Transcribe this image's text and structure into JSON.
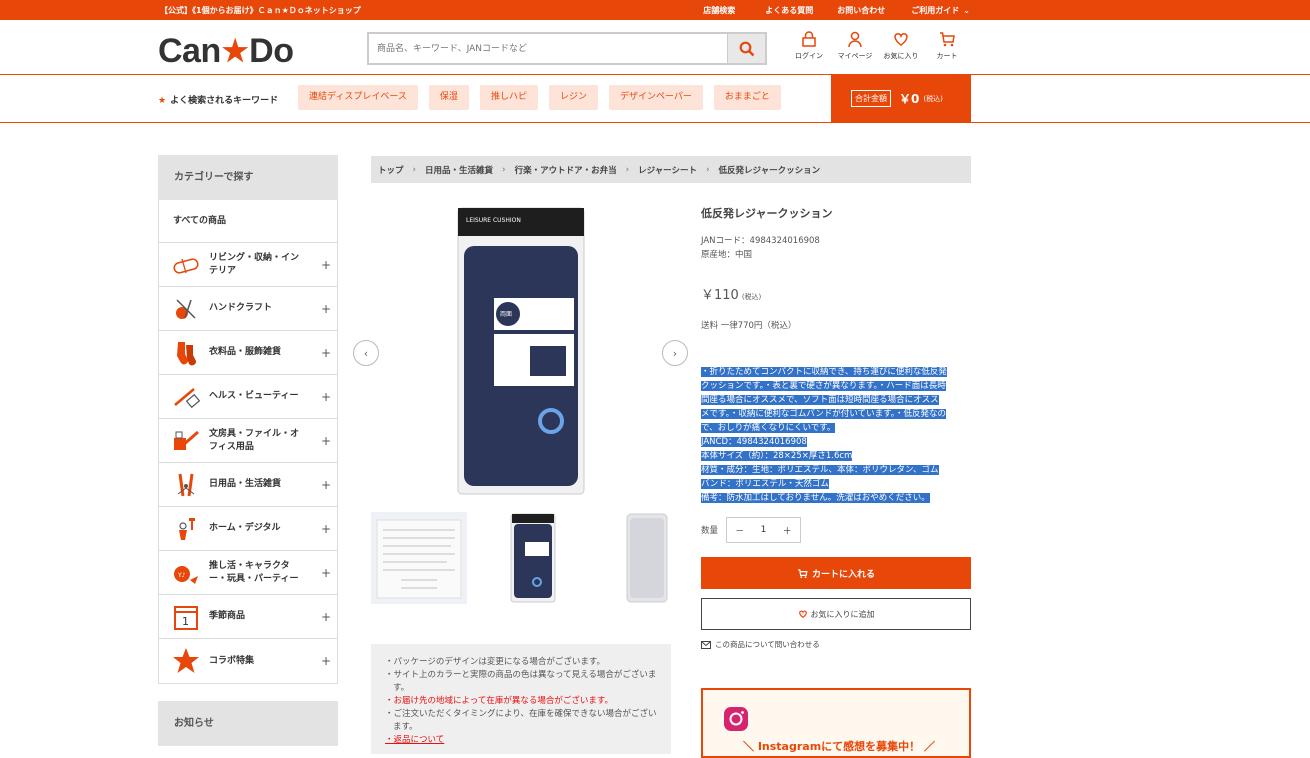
{
  "topbar": {
    "site_title": "【公式】《1個からお届け》Ｃａｎ★Ｄｏネットショップ",
    "links": [
      "店舗検索",
      "よくある質問",
      "お問い合わせ",
      "ご利用ガイド"
    ]
  },
  "header": {
    "logo_left": "Can",
    "logo_star": "★",
    "logo_right": "Do",
    "search_placeholder": "商品名、キーワード、JANコードなど",
    "icons": [
      {
        "label": "ログイン",
        "icon": "lock-icon"
      },
      {
        "label": "マイページ",
        "icon": "user-icon"
      },
      {
        "label": "お気に入り",
        "icon": "heart-icon"
      },
      {
        "label": "カート",
        "icon": "cart-icon"
      }
    ]
  },
  "keywords": {
    "title": "よく検索されるキーワード",
    "tags": [
      "連結ディスプレイベース",
      "保湿",
      "推しハピ",
      "レジン",
      "デザインペーパー",
      "おままごと"
    ]
  },
  "total": {
    "label": "合計金額",
    "amount": "￥0",
    "tax": "(税込)"
  },
  "sidebar": {
    "heading": "カテゴリーで探す",
    "all": "すべての商品",
    "items": [
      {
        "line1": "リビング・収納・イン",
        "line2": "テリア"
      },
      {
        "line1": "ハンドクラフト",
        "line2": ""
      },
      {
        "line1": "衣料品・服飾雑貨",
        "line2": ""
      },
      {
        "line1": "ヘルス・ビューティー",
        "line2": ""
      },
      {
        "line1": "文房具・ファイル・オ",
        "line2": "フィス用品"
      },
      {
        "line1": "日用品・生活雑貨",
        "line2": ""
      },
      {
        "line1": "ホーム・デジタル",
        "line2": ""
      },
      {
        "line1": "推し活・キャラクタ",
        "line2": "ー・玩具・パーティー"
      },
      {
        "line1": "季節商品",
        "line2": ""
      },
      {
        "line1": "コラボ特集",
        "line2": ""
      }
    ],
    "news": "お知らせ"
  },
  "breadcrumb": [
    "トップ",
    "日用品・生活雑貨",
    "行楽・アウトドア・お弁当",
    "レジャーシート",
    "低反発レジャークッション"
  ],
  "product": {
    "name": "低反発レジャークッション",
    "jan": "JANコード：4984324016908",
    "origin": "原産地：中国",
    "price": "￥110",
    "price_tax": "(税込)",
    "shipping": "送料 一律770円（税込）",
    "description": [
      "・折りたためてコンパクトに収納でき、持ち運びに便利な低反発",
      "クッションです。・表と裏で硬さが異なります。・ハード面は長時",
      "間座る場合にオススメで、ソフト面は短時間座る場合にオスス",
      "メです。・収納に便利なゴムバンドが付いています。・低反発なの",
      "で、おしりが痛くなりにくいです。",
      " ",
      "JANCD：4984324016908",
      "本体サイズ（約）：28×25×厚さ1.6cm",
      "材質・成分：生地：ポリエステル、本体：ポリウレタン、ゴム",
      "バンド：ポリエステル・天然ゴム",
      "備考：防水加工はしておりません。洗濯はおやめください。"
    ],
    "qty_label": "数量",
    "qty_value": "1",
    "qty_minus": "－",
    "qty_plus": "＋",
    "cart_button": "カートに入れる",
    "fav_button": "お気に入りに追加",
    "contact": "この商品について問い合わせる",
    "package_label": "LEISURE CUSHION",
    "package_text": "両面使える 低反発 レジャークッション"
  },
  "notes": [
    {
      "text": "・パッケージのデザインは変更になる場合がございます。",
      "red": false
    },
    {
      "text": "・サイト上のカラーと実際の商品の色は異なって見える場合がございます。",
      "red": false
    },
    {
      "text": "・お届け先の地域によって在庫が異なる場合がございます。",
      "red": true
    },
    {
      "text": "・ご注文いただくタイミングにより、在庫を確保できない場合がございます。",
      "red": false
    },
    {
      "text": "・返品について",
      "red": true
    }
  ],
  "instagram": {
    "text": "＼ Instagramにて感想を募集中！ ／"
  },
  "colors": {
    "accent": "#e8470a",
    "tag_bg": "#fde3d8",
    "highlight": "#3372c9"
  }
}
